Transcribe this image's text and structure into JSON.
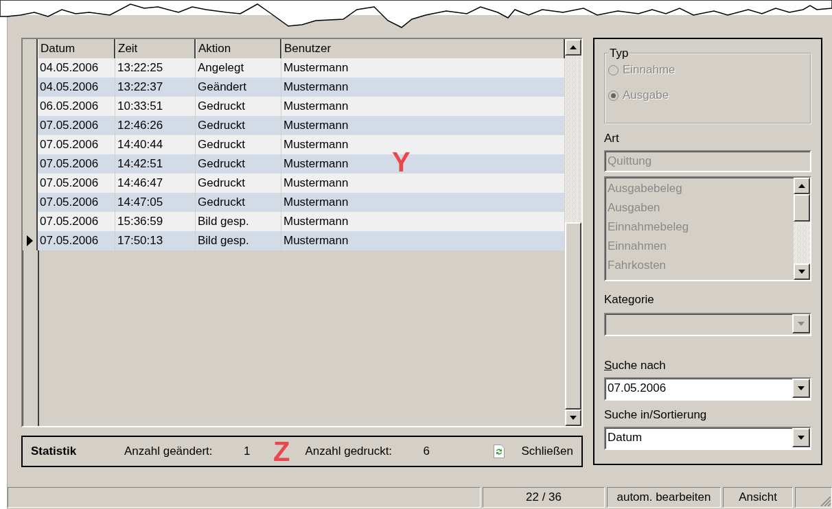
{
  "grid": {
    "columns": [
      "Datum",
      "Zeit",
      "Aktion",
      "Benutzer"
    ],
    "rows": [
      {
        "cells": [
          "04.05.2006",
          "13:22:25",
          "Angelegt",
          "Mustermann"
        ],
        "current": false
      },
      {
        "cells": [
          "04.05.2006",
          "13:22:37",
          "Geändert",
          "Mustermann"
        ],
        "current": false
      },
      {
        "cells": [
          "06.05.2006",
          "10:33:51",
          "Gedruckt",
          "Mustermann"
        ],
        "current": false
      },
      {
        "cells": [
          "07.05.2006",
          "12:46:26",
          "Gedruckt",
          "Mustermann"
        ],
        "current": false
      },
      {
        "cells": [
          "07.05.2006",
          "14:40:44",
          "Gedruckt",
          "Mustermann"
        ],
        "current": false
      },
      {
        "cells": [
          "07.05.2006",
          "14:42:51",
          "Gedruckt",
          "Mustermann"
        ],
        "current": false
      },
      {
        "cells": [
          "07.05.2006",
          "14:46:47",
          "Gedruckt",
          "Mustermann"
        ],
        "current": false
      },
      {
        "cells": [
          "07.05.2006",
          "14:47:05",
          "Gedruckt",
          "Mustermann"
        ],
        "current": false
      },
      {
        "cells": [
          "07.05.2006",
          "15:36:59",
          "Bild gesp.",
          "Mustermann"
        ],
        "current": false
      },
      {
        "cells": [
          "07.05.2006",
          "17:50:13",
          "Bild gesp.",
          "Mustermann"
        ],
        "current": true
      }
    ]
  },
  "annotations": [
    "Y",
    "Z"
  ],
  "statistics": {
    "title": "Statistik",
    "changed_label": "Anzahl geändert:",
    "changed_value": "1",
    "printed_label": "Anzahl gedruckt:",
    "printed_value": "6",
    "close_button": "Schließen"
  },
  "filter": {
    "type_group": {
      "legend": "Typ",
      "disabled": true,
      "options": [
        {
          "label": "Einnahme",
          "selected": false
        },
        {
          "label": "Ausgabe",
          "selected": true
        }
      ]
    },
    "art_label": "Art",
    "art_field": {
      "value": "Quittung",
      "disabled": true
    },
    "art_list": {
      "disabled": true,
      "items": [
        "Ausgabebeleg",
        "Ausgaben",
        "Einnahmebeleg",
        "Einnahmen",
        "Fahrkosten"
      ]
    },
    "category_label": "Kategorie",
    "category_combo": {
      "disabled": true
    },
    "search_label": "Suche nach",
    "search_combo": {
      "value": "07.05.2006",
      "disabled": false
    },
    "sort_label": "Suche in/Sortierung",
    "sort_combo": {
      "value": "Datum",
      "disabled": false
    }
  },
  "status_bar": {
    "panels": [
      "22 / 36",
      "autom. bearbeiten",
      "Ansicht"
    ]
  }
}
